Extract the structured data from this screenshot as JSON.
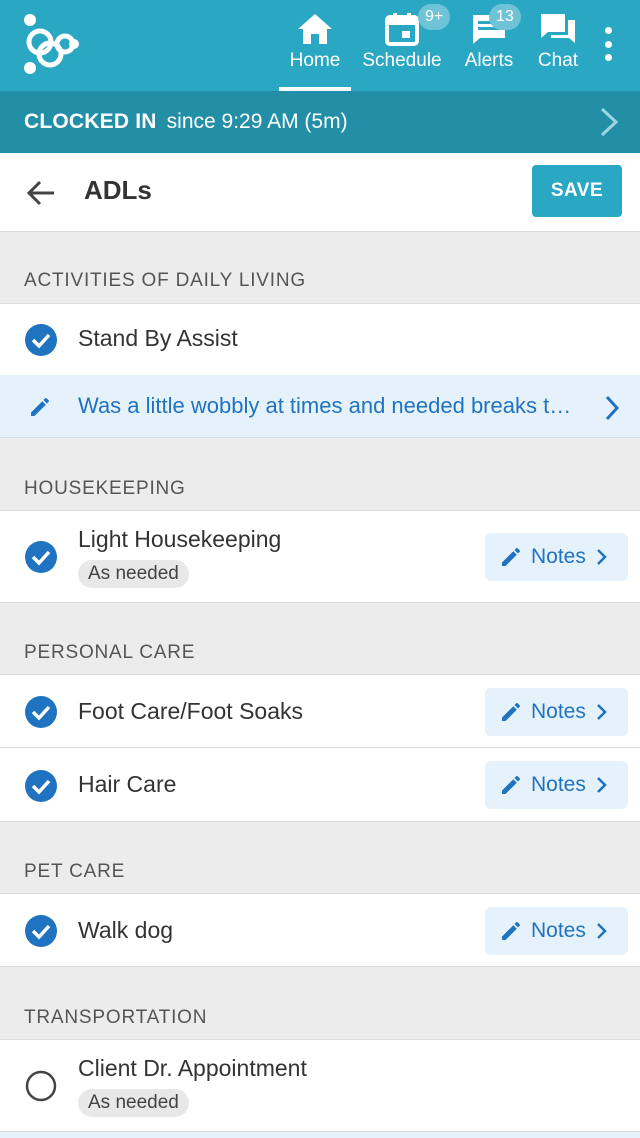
{
  "nav": {
    "items": [
      {
        "label": "Home",
        "icon": "home-icon",
        "active": true,
        "badge": ""
      },
      {
        "label": "Schedule",
        "icon": "calendar-icon",
        "active": false,
        "badge": "9+"
      },
      {
        "label": "Alerts",
        "icon": "alerts-icon",
        "active": false,
        "badge": "13"
      },
      {
        "label": "Chat",
        "icon": "chat-icon",
        "active": false,
        "badge": ""
      }
    ]
  },
  "clock": {
    "status": "CLOCKED IN",
    "since": "since 9:29 AM (5m)"
  },
  "page": {
    "title": "ADLs",
    "save_label": "SAVE"
  },
  "sections": {
    "adl": {
      "title": "ACTIVITIES OF DAILY LIVING",
      "items": [
        {
          "label": "Stand By Assist",
          "checked": true
        }
      ],
      "note": "Was a little wobbly at times and needed breaks t…"
    },
    "housekeeping": {
      "title": "HOUSEKEEPING",
      "items": [
        {
          "label": "Light Housekeeping",
          "tag": "As needed",
          "checked": true,
          "notes_label": "Notes"
        }
      ]
    },
    "personal": {
      "title": "PERSONAL CARE",
      "items": [
        {
          "label": "Foot Care/Foot Soaks",
          "checked": true,
          "notes_label": "Notes"
        },
        {
          "label": "Hair Care",
          "checked": true,
          "notes_label": "Notes"
        }
      ]
    },
    "pet": {
      "title": "PET CARE",
      "items": [
        {
          "label": "Walk dog",
          "checked": true,
          "notes_label": "Notes"
        }
      ]
    },
    "transport": {
      "title": "TRANSPORTATION",
      "items": [
        {
          "label": "Client Dr. Appointment",
          "tag": "As needed",
          "checked": false
        }
      ]
    }
  },
  "colors": {
    "primary": "#2aa7c3",
    "secondary": "#238fa6",
    "link": "#1f73c0",
    "check": "#1f73c0"
  }
}
